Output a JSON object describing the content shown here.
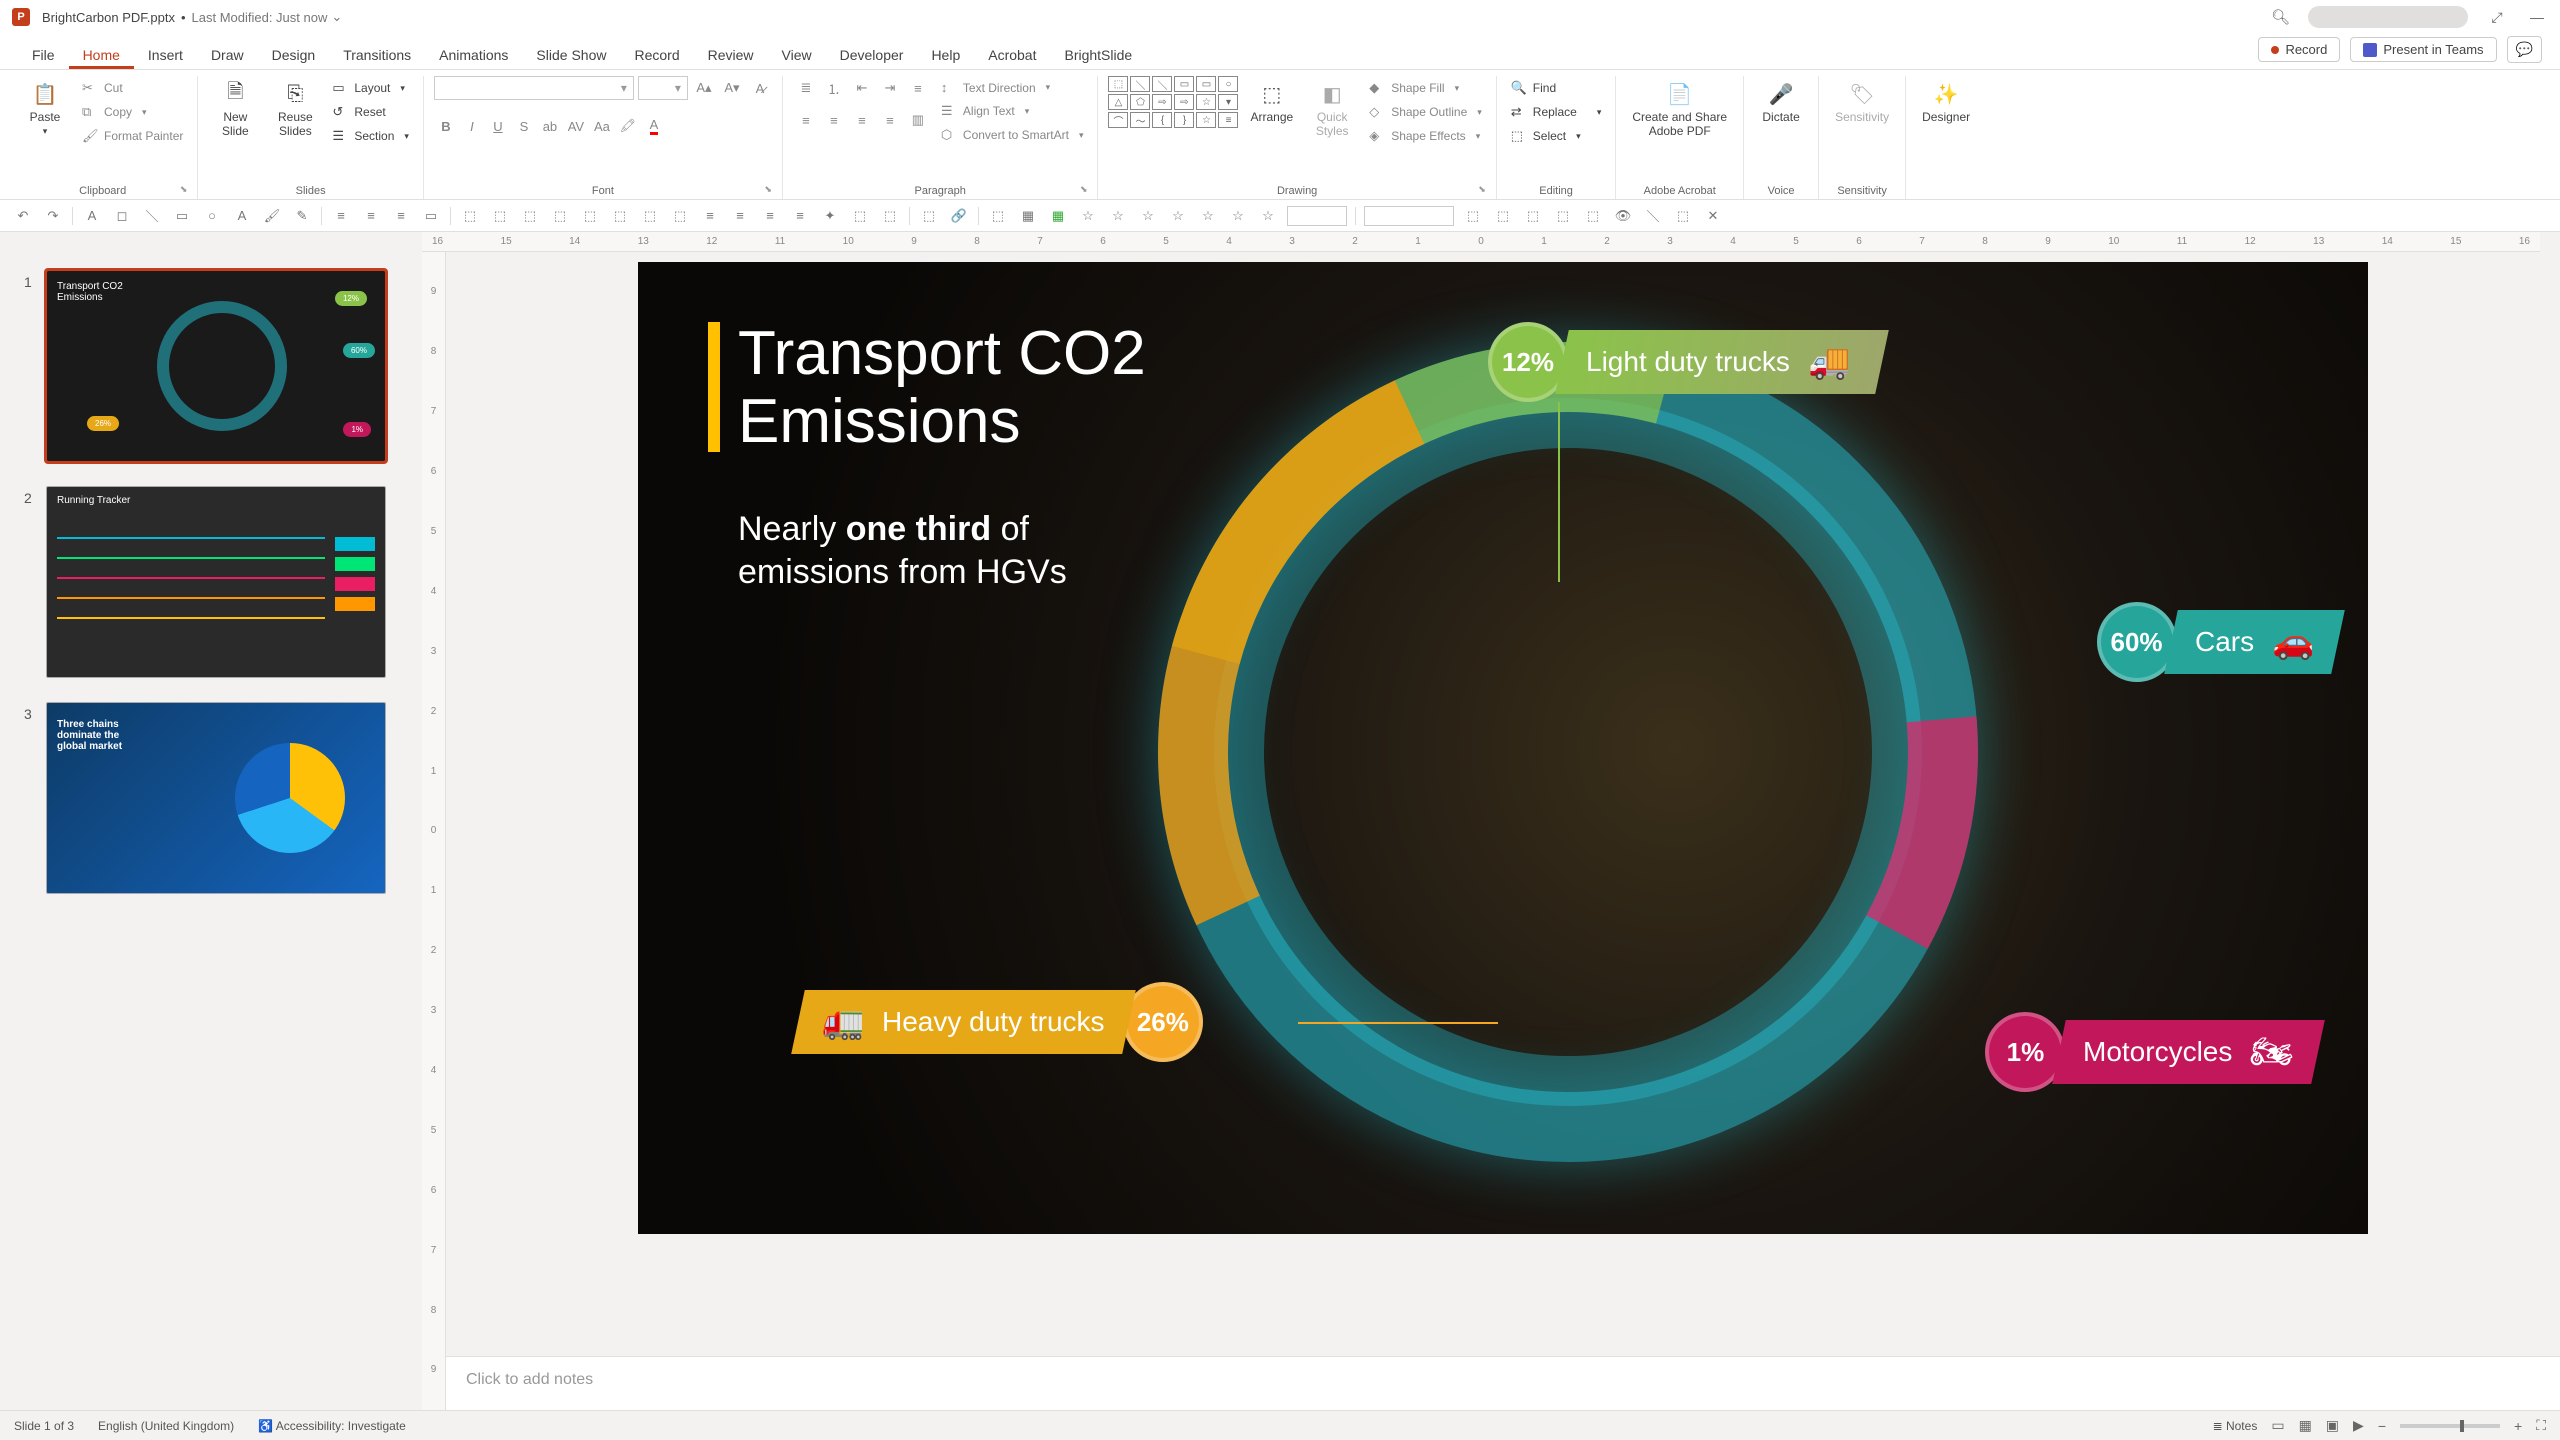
{
  "title_bar": {
    "app_icon": "P",
    "filename": "BrightCarbon PDF.pptx",
    "modified": "Last Modified: Just now"
  },
  "menu": {
    "tabs": [
      "File",
      "Home",
      "Insert",
      "Draw",
      "Design",
      "Transitions",
      "Animations",
      "Slide Show",
      "Record",
      "Review",
      "View",
      "Developer",
      "Help",
      "Acrobat",
      "BrightSlide"
    ],
    "active": "Home",
    "record_btn": "Record",
    "teams_btn": "Present in Teams"
  },
  "ribbon": {
    "clipboard": {
      "label": "Clipboard",
      "paste": "Paste",
      "cut": "Cut",
      "copy": "Copy",
      "fp": "Format Painter"
    },
    "slides": {
      "label": "Slides",
      "new": "New\nSlide",
      "reuse": "Reuse\nSlides",
      "layout": "Layout",
      "reset": "Reset",
      "section": "Section"
    },
    "font": {
      "label": "Font"
    },
    "paragraph": {
      "label": "Paragraph",
      "td": "Text Direction",
      "align": "Align Text",
      "smart": "Convert to SmartArt"
    },
    "drawing": {
      "label": "Drawing",
      "arrange": "Arrange",
      "quick": "Quick\nStyles",
      "fill": "Shape Fill",
      "outline": "Shape Outline",
      "effects": "Shape Effects"
    },
    "editing": {
      "label": "Editing",
      "find": "Find",
      "replace": "Replace",
      "select": "Select"
    },
    "adobe": {
      "label": "Adobe Acrobat",
      "create": "Create and Share\nAdobe PDF"
    },
    "voice": {
      "label": "Voice",
      "dictate": "Dictate"
    },
    "sensitivity": {
      "label": "Sensitivity",
      "btn": "Sensitivity"
    },
    "designer": {
      "btn": "Designer"
    }
  },
  "ruler_h": [
    "16",
    "15",
    "14",
    "13",
    "12",
    "11",
    "10",
    "9",
    "8",
    "7",
    "6",
    "5",
    "4",
    "3",
    "2",
    "1",
    "0",
    "1",
    "2",
    "3",
    "4",
    "5",
    "6",
    "7",
    "8",
    "9",
    "10",
    "11",
    "12",
    "13",
    "14",
    "15",
    "16"
  ],
  "ruler_v": [
    "9",
    "8",
    "7",
    "6",
    "5",
    "4",
    "3",
    "2",
    "1",
    "0",
    "1",
    "2",
    "3",
    "4",
    "5",
    "6",
    "7",
    "8",
    "9"
  ],
  "thumbs": [
    {
      "n": "1",
      "title": "Transport CO2\nEmissions"
    },
    {
      "n": "2",
      "title": "Running Tracker"
    },
    {
      "n": "3",
      "title": "Three chains\ndominate the\nglobal market"
    }
  ],
  "slide": {
    "title": "Transport CO2\nEmissions",
    "subtitle_pre": "Nearly ",
    "subtitle_bold": "one third",
    "subtitle_post": " of\nemissions from HGVs",
    "items": {
      "light": {
        "pct": "12%",
        "label": "Light duty trucks"
      },
      "cars": {
        "pct": "60%",
        "label": "Cars"
      },
      "heavy": {
        "pct": "26%",
        "label": "Heavy duty trucks"
      },
      "moto": {
        "pct": "1%",
        "label": "Motorcycles"
      }
    }
  },
  "notes": {
    "placeholder": "Click to add notes"
  },
  "status": {
    "slide": "Slide 1 of 3",
    "lang": "English (United Kingdom)",
    "access": "Accessibility: Investigate",
    "notes": "Notes"
  },
  "chart_data": {
    "type": "pie",
    "title": "Transport CO2 Emissions",
    "categories": [
      "Cars",
      "Heavy duty trucks",
      "Light duty trucks",
      "Motorcycles"
    ],
    "values": [
      60,
      26,
      12,
      1
    ],
    "colors": [
      "#26a69a",
      "#f5a623",
      "#8bc34a",
      "#c2185b"
    ],
    "unit": "percent",
    "annotation": "Nearly one third of emissions from HGVs"
  }
}
